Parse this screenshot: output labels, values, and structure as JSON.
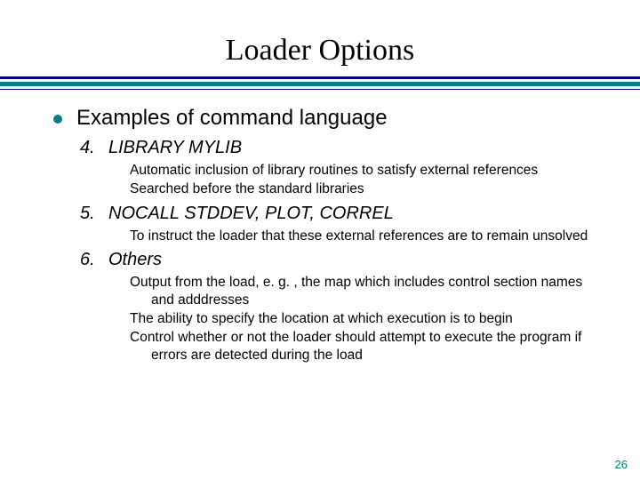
{
  "title": "Loader Options",
  "bullet": "Examples of command language",
  "items": [
    {
      "num": "4.",
      "heading": "LIBRARY MYLIB",
      "lines": [
        "Automatic inclusion of library routines to satisfy external references",
        "Searched before the standard libraries"
      ]
    },
    {
      "num": "5.",
      "heading": "NOCALL STDDEV, PLOT, CORREL",
      "lines": [
        "To instruct the loader that these external references are to remain unsolved"
      ]
    },
    {
      "num": "6.",
      "heading": "Others",
      "lines": [
        "Output from the load, e. g. , the map which includes control section names and adddresses",
        "The ability to specify the location at which execution is to begin",
        "Control whether or not the loader should attempt to execute the program if errors are detected during the load"
      ]
    }
  ],
  "page_number": "26"
}
